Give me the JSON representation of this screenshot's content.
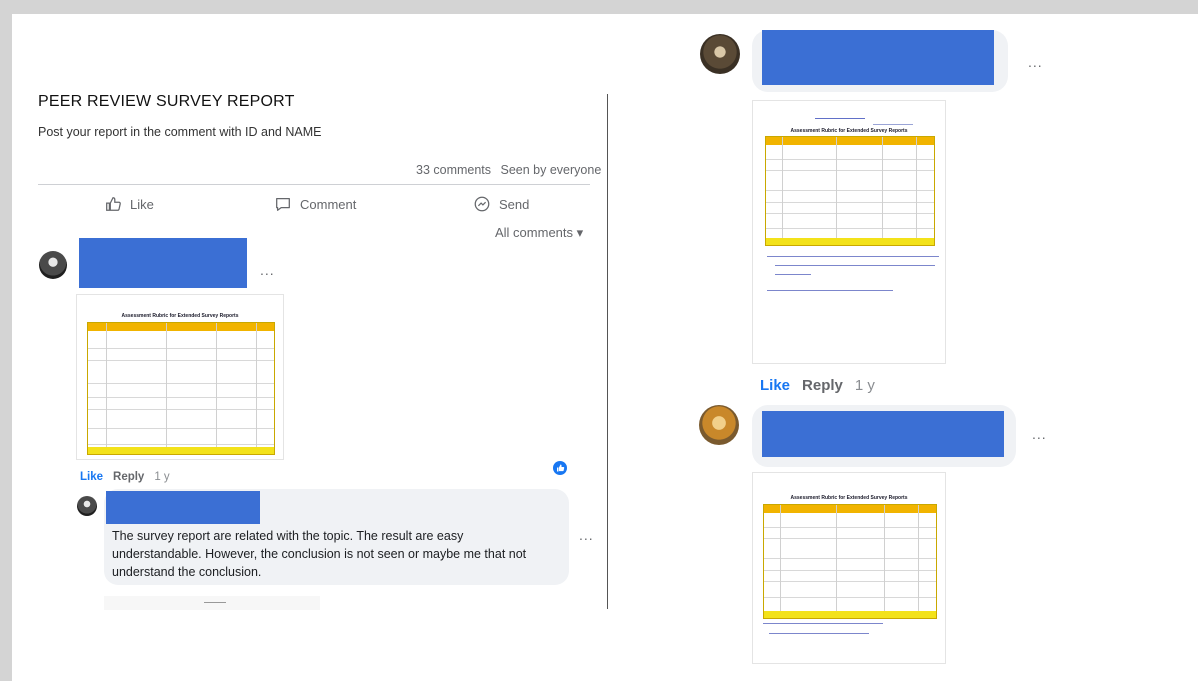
{
  "post": {
    "title": "PEER REVIEW SURVEY REPORT",
    "body": "Post your report in the comment with ID and NAME",
    "comment_count": "33 comments",
    "seen_by": "Seen by everyone"
  },
  "actions": {
    "like": "Like",
    "comment": "Comment",
    "send": "Send"
  },
  "filter": {
    "label": "All comments ▾"
  },
  "comments": [
    {
      "more": "...",
      "attachment_title": "Assessment Rubric for Extended Survey Reports",
      "like": "Like",
      "reply": "Reply",
      "time": "1 y",
      "reply_comment": {
        "text": "The survey report are related with the topic. The result are easy understandable. However, the conclusion is not seen or maybe me that not understand the conclusion.",
        "more": "..."
      }
    },
    {
      "more": "...",
      "attachment_title": "Assessment Rubric for Extended Survey Reports",
      "like": "Like",
      "reply": "Reply",
      "time": "1 y"
    },
    {
      "more": "...",
      "attachment_title": "Assessment Rubric for Extended Survey Reports"
    }
  ],
  "colors": {
    "redaction": "#3b6fd4",
    "accent": "#1877f2",
    "rubric_header": "#f1b400",
    "rubric_footer": "#f3e21a"
  }
}
